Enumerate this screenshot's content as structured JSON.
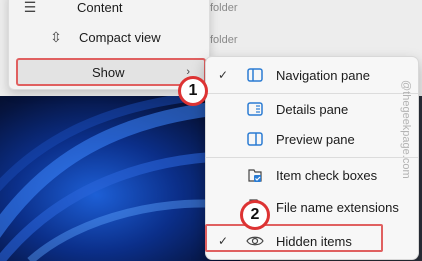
{
  "background": {
    "folder_1": "folder",
    "folder_2": "folder"
  },
  "main_menu": {
    "items": [
      {
        "label": "Content",
        "icon": "content-icon"
      },
      {
        "label": "Compact view",
        "icon": "compact-view-icon"
      },
      {
        "label": "Show",
        "icon": "chevron-right-icon"
      }
    ]
  },
  "sub_menu": {
    "items": [
      {
        "label": "Navigation pane",
        "checked": true,
        "icon": "navigation-pane-icon"
      },
      {
        "label": "Details pane",
        "checked": false,
        "icon": "details-pane-icon"
      },
      {
        "label": "Preview pane",
        "checked": false,
        "icon": "preview-pane-icon"
      },
      {
        "label": "Item check boxes",
        "checked": false,
        "icon": "checkbox-icon"
      },
      {
        "label": "File name extensions",
        "checked": false,
        "icon": "file-icon"
      },
      {
        "label": "Hidden items",
        "checked": true,
        "icon": "eye-icon"
      }
    ]
  },
  "badges": {
    "step1": "1",
    "step2": "2"
  },
  "watermark": "@thegeekpage.com",
  "colors": {
    "highlight_border": "#e06060",
    "accent": "#2b7cd3"
  }
}
